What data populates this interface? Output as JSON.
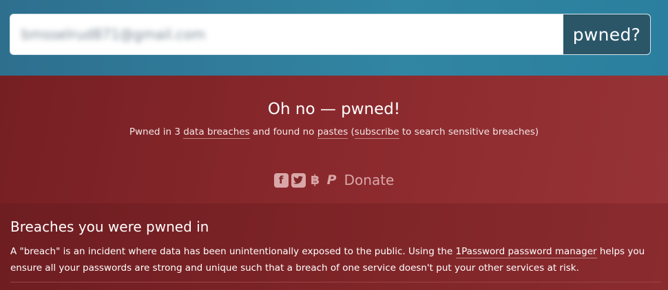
{
  "search": {
    "value": "bmsselrud871@gmail.com",
    "button_label": "pwned?"
  },
  "result": {
    "title": "Oh no — pwned!",
    "summary_prefix": "Pwned in 3 ",
    "data_breaches_link": "data breaches",
    "summary_mid": " and found no ",
    "pastes_link": "pastes",
    "summary_open": " (",
    "subscribe_link": "subscribe",
    "summary_suffix": " to search sensitive breaches)"
  },
  "donate": {
    "icons": [
      "facebook-icon",
      "twitter-icon",
      "bitcoin-icon",
      "paypal-icon"
    ],
    "label": "Donate"
  },
  "breaches": {
    "heading": "Breaches you were pwned in",
    "desc_prefix": "A \"breach\" is an incident where data has been unintentionally exposed to the public. Using the ",
    "password_manager_link": "1Password password manager",
    "desc_suffix": " helps you ensure all your passwords are strong and unique such that a breach of one service doesn't put your other services at risk."
  },
  "colors": {
    "search_band": "#3186a3",
    "search_button": "#2a5668",
    "result_band": "#8a292d",
    "breaches_band": "#7f2528"
  }
}
